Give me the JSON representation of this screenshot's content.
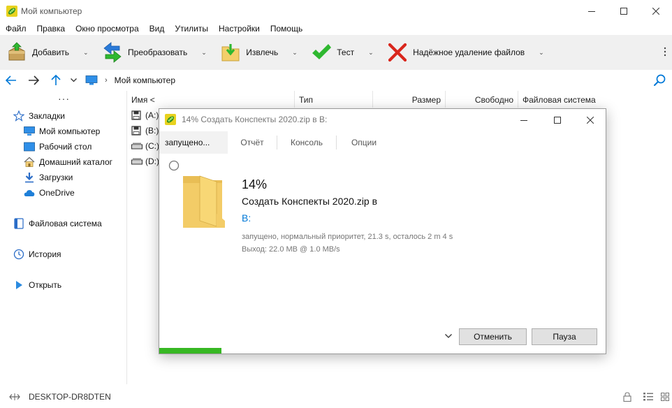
{
  "window": {
    "title": "Мой компьютер",
    "controls": [
      "minimize-icon",
      "maximize-icon",
      "close-icon"
    ]
  },
  "menu": [
    "Файл",
    "Правка",
    "Окно просмотра",
    "Вид",
    "Утилиты",
    "Настройки",
    "Помощь"
  ],
  "toolbar": {
    "add": "Добавить",
    "convert": "Преобразовать",
    "extract": "Извлечь",
    "test": "Тест",
    "secure_delete": "Надёжное удаление файлов"
  },
  "address": {
    "path": "Мой компьютер"
  },
  "sidebar": {
    "bookmarks": "Закладки",
    "items": [
      "Мой компьютер",
      "Рабочий стол",
      "Домашний каталог",
      "Загрузки",
      "OneDrive"
    ],
    "filesystem": "Файловая система",
    "history": "История",
    "open": "Открыть"
  },
  "filelist": {
    "columns": [
      "Имя <",
      "Тип",
      "Размер",
      "Свободно",
      "Файловая система"
    ],
    "drives": [
      "(A:)",
      "(B:)",
      "(C:)",
      "(D:)"
    ]
  },
  "status": {
    "computer": "DESKTOP-DR8DTEN"
  },
  "dialog": {
    "title": "14% Создать Конспекты 2020.zip в B:",
    "tabs": [
      "запущено...",
      "Отчёт",
      "Консоль",
      "Опции"
    ],
    "percent": "14%",
    "action": "Создать Конспекты 2020.zip в",
    "target": "B:",
    "status_line": "запущено, нормальный приоритет, 21.3 s, осталось 2 m 4 s",
    "output_line": "Выход: 22.0 MB @ 1.0 MB/s",
    "cancel": "Отменить",
    "pause": "Пауза",
    "progress": 0.14
  },
  "colors": {
    "accent_blue": "#0078d7",
    "progress_green": "#37b823",
    "folder_yellow": "#f8d775",
    "delete_red": "#d9261c",
    "check_green": "#2fb830"
  }
}
